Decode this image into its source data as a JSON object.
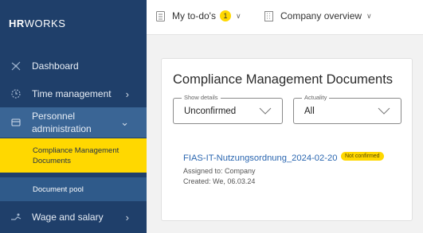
{
  "logo": {
    "bold": "HR",
    "rest": "WORKS"
  },
  "sidebar": {
    "items": [
      {
        "label": "Dashboard",
        "icon": "dashboard-icon"
      },
      {
        "label": "Time management",
        "icon": "clock-icon"
      },
      {
        "label": "Personnel administration",
        "icon": "folder-icon"
      },
      {
        "label": "Wage and salary",
        "icon": "wage-icon"
      }
    ],
    "subitems": [
      {
        "label": "Compliance Management Documents",
        "active": true
      },
      {
        "label": "Document pool"
      }
    ]
  },
  "topbar": {
    "todo_label": "My to-do's",
    "todo_count": "1",
    "company_label": "Company overview"
  },
  "card": {
    "title": "Compliance Management Documents",
    "details": {
      "legend": "Show details",
      "value": "Unconfirmed"
    },
    "actuality": {
      "legend": "Actuality",
      "value": "All"
    },
    "document": {
      "name": "FIAS-IT-Nutzungsordnung_2024-02-20",
      "status": "Not confirmed",
      "assigned": "Assigned to: Company",
      "created": "Created: We, 06.03.24"
    }
  },
  "colors": {
    "sidebar": "#1f3f6a",
    "accent": "#ffd800",
    "link": "#2a66b0"
  }
}
